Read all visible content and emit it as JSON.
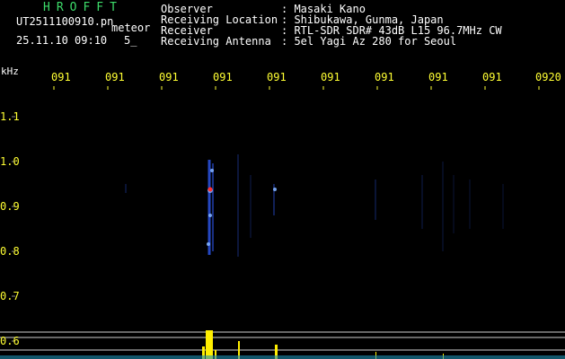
{
  "header": {
    "app_title": "HROFFT",
    "file_name": "UT2511100910.pn",
    "detection_type": "meteor",
    "datetime": "25.11.10 09:10",
    "count": "5_"
  },
  "station_info": [
    {
      "label": "Observer",
      "value": ": Masaki Kano"
    },
    {
      "label": "Receiving Location",
      "value": ": Shibukawa, Gunma, Japan"
    },
    {
      "label": "Receiver",
      "value": ": RTL-SDR SDR# 43dB L15 96.7MHz CW"
    },
    {
      "label": "Receiving Antenna",
      "value": ": 5el Yagi Az 280 for Seoul"
    }
  ],
  "axis": {
    "freq_unit": "kHz",
    "time_ticks": [
      "091",
      "091",
      "091",
      "091",
      "091",
      "091",
      "091",
      "091",
      "091",
      "0920"
    ],
    "freq_ticks": [
      "1.1",
      "1.0",
      "0.9",
      "0.8",
      "0.7",
      "0.6"
    ]
  },
  "colors": {
    "background": "#000000",
    "header_text": "#ffffff",
    "app_title": "#3ddc6a",
    "tick_labels": "#ffff33",
    "signal_blue": "#2a4fd8",
    "signal_red": "#ff3030",
    "bar_yellow": "#ffee00"
  }
}
